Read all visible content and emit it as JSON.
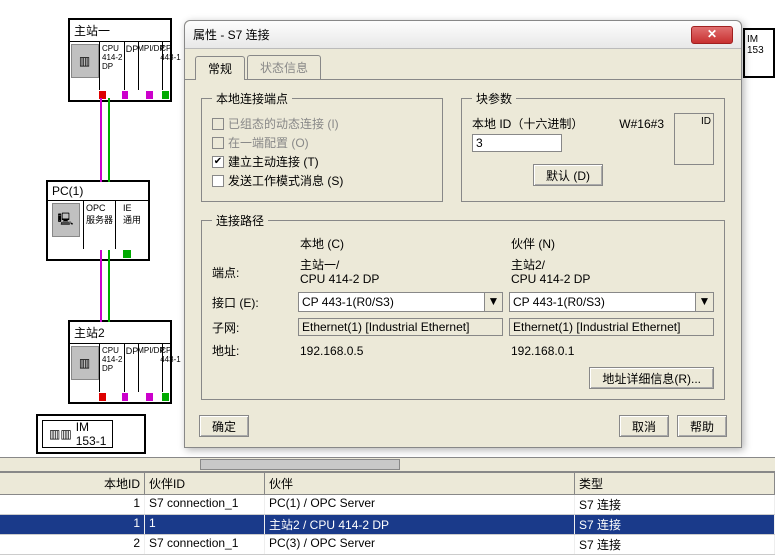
{
  "background": {
    "station1": {
      "title": "主站一",
      "cpu": "CPU\n414-2\nDP",
      "dp": "DP",
      "mpi": "MPI/DP",
      "cp": "CP\n443-1"
    },
    "pc1": {
      "title": "PC(1)",
      "opc": "OPC\n服务器",
      "ie": "IE\n通用"
    },
    "station2": {
      "title": "主站2",
      "cpu": "CPU\n414-2\nDP",
      "dp": "DP",
      "mpi": "MPI/DP",
      "cp": "CP\n443-1"
    },
    "im": {
      "label": "IM\n153-1"
    },
    "im_right": "IM\n153"
  },
  "dialog": {
    "title": "属性 - S7 连接",
    "tabs": {
      "general": "常规",
      "status": "状态信息"
    },
    "local_endpoint": {
      "legend": "本地连接端点",
      "dyn": "已组态的动态连接 (I)",
      "one_end": "在一端配置 (O)",
      "active": "建立主动连接 (T)",
      "workmode": "发送工作模式消息 (S)"
    },
    "block": {
      "legend": "块参数",
      "id_label": "本地 ID（十六进制）",
      "hex": "W#16#3",
      "id_value": "3",
      "slot_label": "ID",
      "default_btn": "默认 (D)"
    },
    "path": {
      "legend": "连接路径",
      "col_local": "本地 (C)",
      "col_partner": "伙伴 (N)",
      "row_endpoint": "端点:",
      "row_interface": "接口 (E):",
      "row_subnet": "子网:",
      "row_addr": "地址:",
      "local": {
        "endpoint": "主站一/\nCPU 414-2 DP",
        "interface": "CP 443-1(R0/S3)",
        "subnet": "Ethernet(1) [Industrial Ethernet]",
        "addr": "192.168.0.5"
      },
      "partner": {
        "endpoint": "主站2/\nCPU 414-2 DP",
        "interface": "CP 443-1(R0/S3)",
        "subnet": "Ethernet(1) [Industrial Ethernet]",
        "addr": "192.168.0.1"
      },
      "detail_btn": "地址详细信息(R)..."
    },
    "buttons": {
      "ok": "确定",
      "cancel": "取消",
      "help": "帮助"
    }
  },
  "table": {
    "headers": {
      "local_id": "本地ID",
      "partner_id": "伙伴ID",
      "partner": "伙伴",
      "type": "类型"
    },
    "rows": [
      {
        "local_id": "1",
        "partner_id": "S7 connection_1",
        "partner": "PC(1) / OPC Server",
        "type": "S7 连接"
      },
      {
        "local_id": "1",
        "partner_id": "1",
        "partner": "主站2 / CPU 414-2 DP",
        "type": "S7 连接"
      },
      {
        "local_id": "2",
        "partner_id": "S7 connection_1",
        "partner": "PC(3) / OPC Server",
        "type": "S7 连接"
      }
    ]
  }
}
